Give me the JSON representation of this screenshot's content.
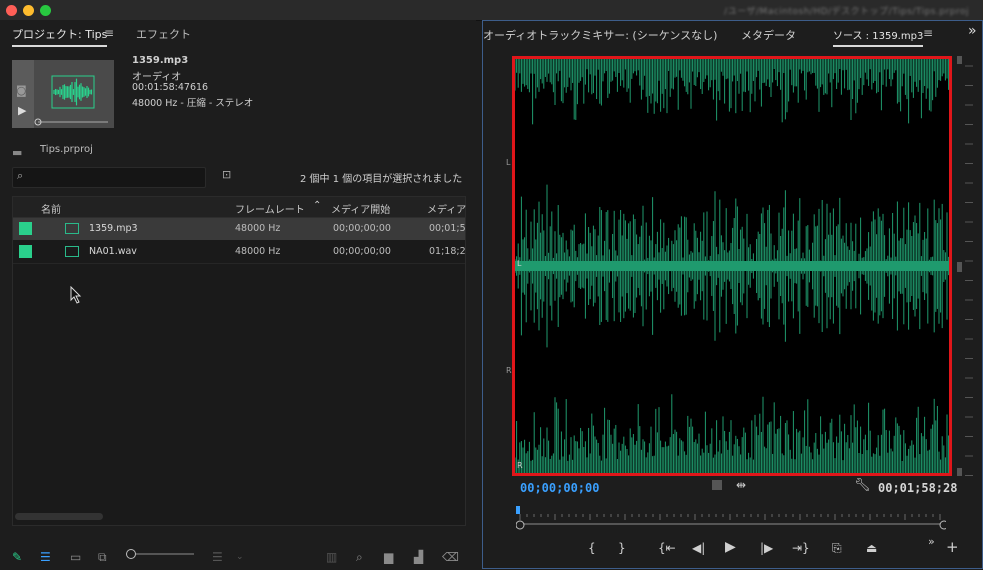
{
  "window": {
    "title": "/ユーザ/Macintosh/HD/デスクトップ/Tips/Tips.prproj"
  },
  "colors": {
    "accent_blue": "#3aa0ff",
    "label_green": "#2ad08c",
    "waveform": "#1f9a6e",
    "highlight": "#e0161a"
  },
  "project_panel": {
    "tabs": [
      {
        "label": "プロジェクト: Tips"
      },
      {
        "label": "エフェクト"
      }
    ],
    "menu_icon": "hamburger-icon",
    "preview": {
      "name": "1359.mp3",
      "type": "オーディオ",
      "duration": "00:01:58:47616",
      "format": "48000 Hz - 圧縮 - ステレオ"
    },
    "project_file": "Tips.prproj",
    "search": {
      "placeholder": ""
    },
    "selection_status": "2 個中 1 個の項目が選択されました",
    "columns": [
      "名前",
      "フレームレート",
      "メディア開始",
      "メディア"
    ],
    "items": [
      {
        "name": "1359.mp3",
        "rate": "48000 Hz",
        "start": "00;00;00;00",
        "end": "00;01;5",
        "selected": true
      },
      {
        "name": "NA01.wav",
        "rate": "48000 Hz",
        "start": "00;00;00;00",
        "end": "01;18;2",
        "selected": false
      }
    ]
  },
  "monitor_panel": {
    "tabs": [
      {
        "label": "オーディオトラックミキサー: (シーケンスなし)"
      },
      {
        "label": "メタデータ"
      },
      {
        "label": "ソース : 1359.mp3"
      }
    ],
    "channel_labels": {
      "left": "L",
      "right": "R"
    },
    "timecode_in": "00;00;00;00",
    "timecode_duration": "00;01;58;28"
  }
}
